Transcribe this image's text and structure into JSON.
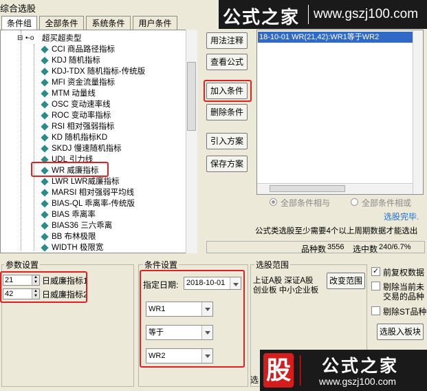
{
  "window": {
    "title": "综合选股"
  },
  "tabs": [
    "条件组",
    "全部条件",
    "系统条件",
    "用户条件"
  ],
  "tree": {
    "root": "超买超卖型",
    "items": [
      "CCI 商品路径指标",
      "KDJ 随机指标",
      "KDJ-TDX 随机指标-传统版",
      "MFI 资金流量指标",
      "MTM 动量线",
      "OSC 变动速率线",
      "ROC 变动率指标",
      "RSI 相对强弱指标",
      "KD 随机指标KD",
      "SKDJ 慢速随机指标",
      "UDL 引力线",
      "WR 威廉指标",
      "LWR LWR威廉指标",
      "MARSI 相对强弱平均线",
      "BIAS-QL 乖离率-传统版",
      "BIAS 乖离率",
      "BIAS36 三六乖离",
      "BB 布林极限",
      "WIDTH 极限宽"
    ]
  },
  "buttons": {
    "usage": "用法注释",
    "view_formula": "查看公式",
    "add_condition": "加入条件",
    "delete_condition": "删除条件",
    "import_plan": "引入方案",
    "save_plan": "保存方案",
    "change_range": "改变范围",
    "select_to_block": "选股入板块"
  },
  "condition_list": {
    "selected": "18-10-01 WR(21,42):WR1等于WR2"
  },
  "logic": {
    "and_label": "全部条件相与",
    "or_label": "全部条件相或"
  },
  "status": {
    "done": "选股完毕.",
    "note": "公式类选股至少需要4个以上周期数据才能选出",
    "total_label": "品种数",
    "total_value": "3556",
    "selected_label": "选中数",
    "selected_value": "240/6.7%"
  },
  "params": {
    "title": "参数设置",
    "rows": [
      {
        "value": "21",
        "label": "日威廉指标1"
      },
      {
        "value": "42",
        "label": "日威廉指标2"
      }
    ]
  },
  "cond_settings": {
    "title": "条件设置",
    "date_label": "指定日期:",
    "date_value": "2018-10-01",
    "left": "WR1",
    "op": "等于",
    "right": "WR2"
  },
  "range": {
    "title": "选股范围",
    "line1": "上证A股 深证A股",
    "line2": "创业板 中小企业板",
    "bottom_label": "选"
  },
  "options": {
    "adjust": "前复权数据",
    "exclude_suspended_1": "剔除当前未",
    "exclude_suspended_2": "交易的品种",
    "exclude_st": "剔除ST品种"
  },
  "watermark": {
    "brand": "公式之家",
    "url": "www.gszj100.com",
    "stock": "股"
  },
  "colors": {
    "highlight": "#e02020",
    "selection": "#3169c6",
    "link": "#1e6fd9"
  }
}
